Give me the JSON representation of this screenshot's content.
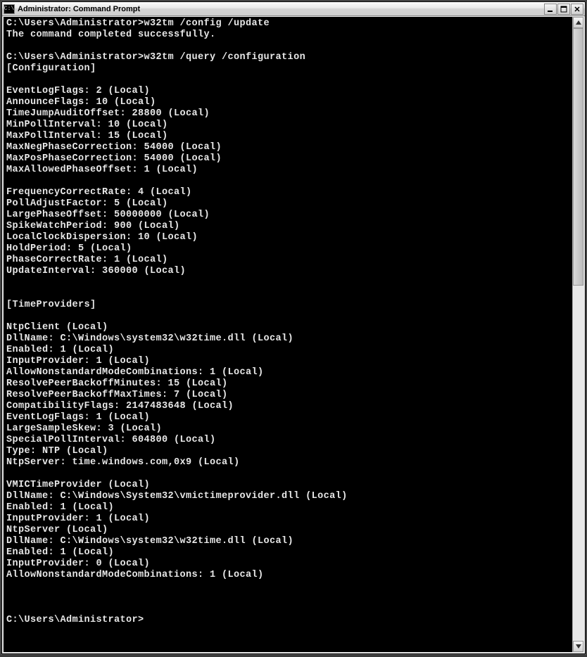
{
  "window": {
    "title": "Administrator: Command Prompt",
    "icon_label": "C:\\"
  },
  "console": {
    "lines": [
      "C:\\Users\\Administrator>w32tm /config /update",
      "The command completed successfully.",
      "",
      "C:\\Users\\Administrator>w32tm /query /configuration",
      "[Configuration]",
      "",
      "EventLogFlags: 2 (Local)",
      "AnnounceFlags: 10 (Local)",
      "TimeJumpAuditOffset: 28800 (Local)",
      "MinPollInterval: 10 (Local)",
      "MaxPollInterval: 15 (Local)",
      "MaxNegPhaseCorrection: 54000 (Local)",
      "MaxPosPhaseCorrection: 54000 (Local)",
      "MaxAllowedPhaseOffset: 1 (Local)",
      "",
      "FrequencyCorrectRate: 4 (Local)",
      "PollAdjustFactor: 5 (Local)",
      "LargePhaseOffset: 50000000 (Local)",
      "SpikeWatchPeriod: 900 (Local)",
      "LocalClockDispersion: 10 (Local)",
      "HoldPeriod: 5 (Local)",
      "PhaseCorrectRate: 1 (Local)",
      "UpdateInterval: 360000 (Local)",
      "",
      "",
      "[TimeProviders]",
      "",
      "NtpClient (Local)",
      "DllName: C:\\Windows\\system32\\w32time.dll (Local)",
      "Enabled: 1 (Local)",
      "InputProvider: 1 (Local)",
      "AllowNonstandardModeCombinations: 1 (Local)",
      "ResolvePeerBackoffMinutes: 15 (Local)",
      "ResolvePeerBackoffMaxTimes: 7 (Local)",
      "CompatibilityFlags: 2147483648 (Local)",
      "EventLogFlags: 1 (Local)",
      "LargeSampleSkew: 3 (Local)",
      "SpecialPollInterval: 604800 (Local)",
      "Type: NTP (Local)",
      "NtpServer: time.windows.com,0x9 (Local)",
      "",
      "VMICTimeProvider (Local)",
      "DllName: C:\\Windows\\System32\\vmictimeprovider.dll (Local)",
      "Enabled: 1 (Local)",
      "InputProvider: 1 (Local)",
      "NtpServer (Local)",
      "DllName: C:\\Windows\\system32\\w32time.dll (Local)",
      "Enabled: 1 (Local)",
      "InputProvider: 0 (Local)",
      "AllowNonstandardModeCombinations: 1 (Local)",
      "",
      "",
      "",
      "C:\\Users\\Administrator>"
    ]
  }
}
